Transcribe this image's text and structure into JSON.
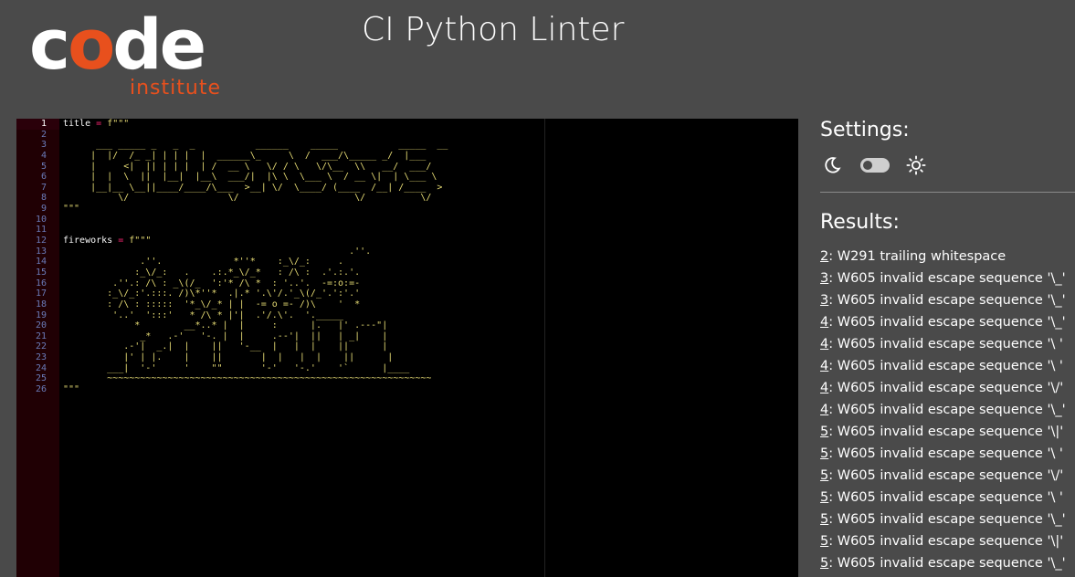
{
  "header": {
    "logo_word_c": "c",
    "logo_word_o": "o",
    "logo_word_de": "de",
    "logo_sub": "institute",
    "title": "CI Python Linter"
  },
  "editor": {
    "line_numbers": [
      "1",
      "2",
      "3",
      "4",
      "5",
      "6",
      "7",
      "8",
      "9",
      "10",
      "11",
      "12",
      "13",
      "14",
      "15",
      "16",
      "17",
      "18",
      "19",
      "20",
      "21",
      "22",
      "23",
      "24",
      "25",
      "26"
    ],
    "active_line": "1",
    "title_var": "title",
    "fireworks_var": "fireworks",
    "assign_op": "=",
    "fstring_open": "f\"\"\"",
    "fstring_close": "\"\"\"",
    "title_art": [
      "",
      "      ___ _____ _   _  _           ______    _____           _____  __  ",
      "     |  |/  /_ _| | | |  |  ______\\_     \\  /  ___/\\_____ _/  |___ ",
      "     |     <|  || | | |  | /  __ \\   \\/ / \\   \\/\\__  \\\\   __/  ___/",
      "     |  |  \\  ||  |__|  |__\\  ___/|  |\\ \\  \\___ \\  / __ \\|  | \\___ \\ ",
      "     |__|__ \\__||____/____/\\___  >__| \\/  \\____/ (____  /__| /____  >",
      "          \\/                  \\/                     \\/          \\/ "
    ],
    "fireworks_art": [
      "                                                    .''.",
      "              .''.             *''*    :_\\/_:     .",
      "             :_\\/_:   .    .:.*_\\/_*   : /\\ :  .'.:.'.",
      "         .''.: /\\ : _\\(/_  ':'* /\\ *  : '..'.  -=:o:=-",
      "        :_\\/_:'.:::. /)\\*''*  .|.* '.\\'/.'_\\(/_'.':'.'",
      "        : /\\ : :::::  '*_\\/_* | |  -= o =- /)\\    '  *",
      "         '..'  ':::'   * /\\ * |'|  .'/.\\'.  '._____",
      "             *        __*..* |  |     :      |.   |' .---\"|",
      "              _*   .-'   '-. |  |     .--'|  ||   | _|    |",
      "           .-'|  _.|  |    ||   '-__  |   |  |    ||      |",
      "           |' | |.    |    ||       |  |   |  |    ||      |",
      "        ___|  '-'     '    \"\"       '-'   '-.'    '`      |____",
      "        ~~~~~~~~~~~~~~~~~~~~~~~~~~~~~~~~~~~~~~~~~~~~~~~~~~~~~~~~~~~"
    ]
  },
  "settings": {
    "title": "Settings:",
    "theme_dark_icon": "moon-icon",
    "theme_light_icon": "sun-icon",
    "theme_toggle_state": "off"
  },
  "results": {
    "title": "Results:",
    "items": [
      {
        "line": "2",
        "message": ": W291 trailing whitespace"
      },
      {
        "line": "3",
        "message": ": W605 invalid escape sequence '\\_'"
      },
      {
        "line": "3",
        "message": ": W605 invalid escape sequence '\\_'"
      },
      {
        "line": "4",
        "message": ": W605 invalid escape sequence '\\_'"
      },
      {
        "line": "4",
        "message": ": W605 invalid escape sequence '\\ '"
      },
      {
        "line": "4",
        "message": ": W605 invalid escape sequence '\\ '"
      },
      {
        "line": "4",
        "message": ": W605 invalid escape sequence '\\/'"
      },
      {
        "line": "4",
        "message": ": W605 invalid escape sequence '\\_'"
      },
      {
        "line": "5",
        "message": ": W605 invalid escape sequence '\\|'"
      },
      {
        "line": "5",
        "message": ": W605 invalid escape sequence '\\ '"
      },
      {
        "line": "5",
        "message": ": W605 invalid escape sequence '\\/'"
      },
      {
        "line": "5",
        "message": ": W605 invalid escape sequence '\\ '"
      },
      {
        "line": "5",
        "message": ": W605 invalid escape sequence '\\_'"
      },
      {
        "line": "5",
        "message": ": W605 invalid escape sequence '\\|'"
      },
      {
        "line": "5",
        "message": ": W605 invalid escape sequence '\\_'"
      }
    ]
  },
  "colors": {
    "background": "#4a4a4a",
    "brand_orange": "#e8501d",
    "editor_bg": "#000000",
    "gutter_bg": "#200004",
    "string_yellow": "#e6db74",
    "operator_pink": "#f92672"
  }
}
